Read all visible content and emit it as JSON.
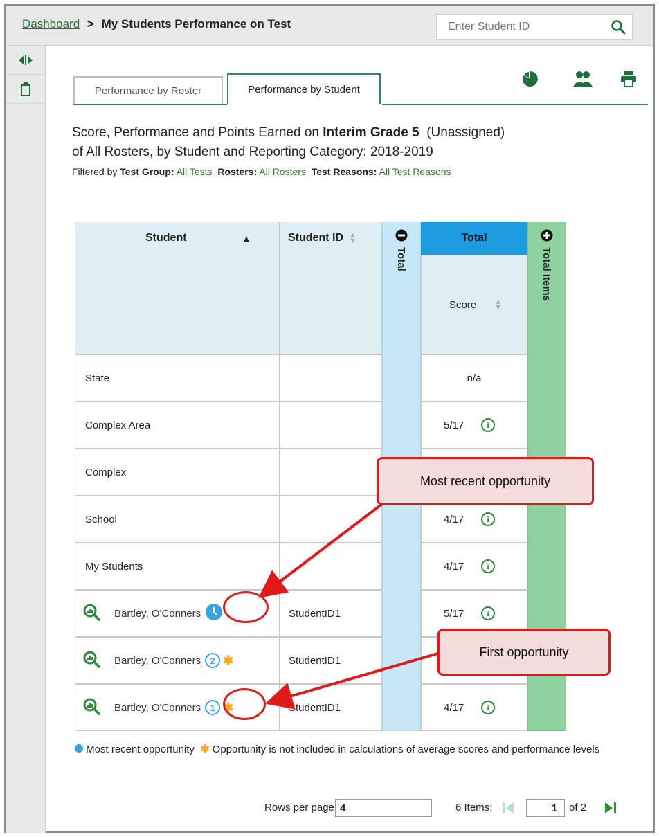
{
  "breadcrumb": {
    "dashboard": "Dashboard",
    "current": "My Students Performance on Test"
  },
  "search": {
    "placeholder": "Enter Student ID"
  },
  "tabs": [
    {
      "label": "Performance by Roster"
    },
    {
      "label": "Performance by Student"
    }
  ],
  "report": {
    "title_prefix": "Score, Performance and Points Earned on ",
    "title_test": "Interim Grade 5",
    "title_suffix": "(Unassigned)",
    "title_line2": "of All Rosters, by Student and Reporting Category: 2018-2019",
    "filter": {
      "filtered_by": "Filtered by",
      "test_group_label": "Test Group:",
      "test_group_value": "All Tests",
      "rosters_label": "Rosters:",
      "rosters_value": "All Rosters",
      "reasons_label": "Test Reasons:",
      "reasons_value": "All Test Reasons"
    }
  },
  "table": {
    "headers": {
      "student": "Student",
      "student_id": "Student ID",
      "total_collapsed": "Total",
      "total": "Total",
      "score": "Score",
      "total_items": "Total Items"
    },
    "aggregate_rows": [
      {
        "name": "State",
        "score": "n/a"
      },
      {
        "name": "Complex Area",
        "score": "5/17"
      },
      {
        "name": "Complex",
        "score": ""
      },
      {
        "name": "School",
        "score": "4/17"
      },
      {
        "name": "My Students",
        "score": "4/17"
      }
    ],
    "student_rows": [
      {
        "name": "Bartley, O'Conners",
        "id": "StudentID1",
        "score": "5/17",
        "opportunity": "most-recent"
      },
      {
        "name": "Bartley, O'Conners",
        "id": "StudentID1",
        "score": "",
        "opportunity": "2"
      },
      {
        "name": "Bartley, O'Conners",
        "id": "StudentID1",
        "score": "4/17",
        "opportunity": "1"
      }
    ]
  },
  "callouts": {
    "most_recent": "Most recent opportunity",
    "first": "First opportunity"
  },
  "legend": {
    "most_recent": "Most recent opportunity",
    "not_included": "Opportunity is not included in calculations of average scores and performance levels"
  },
  "pager": {
    "rows_label": "Rows per page:",
    "rows_value": "4",
    "items_label": "6 Items:",
    "page_value": "1",
    "of_label": "of 2"
  },
  "colors": {
    "accent_green": "#2d8a55",
    "total_blue": "#1c9be0",
    "callout_red": "#e01a1a",
    "asterisk": "#f5a623"
  }
}
